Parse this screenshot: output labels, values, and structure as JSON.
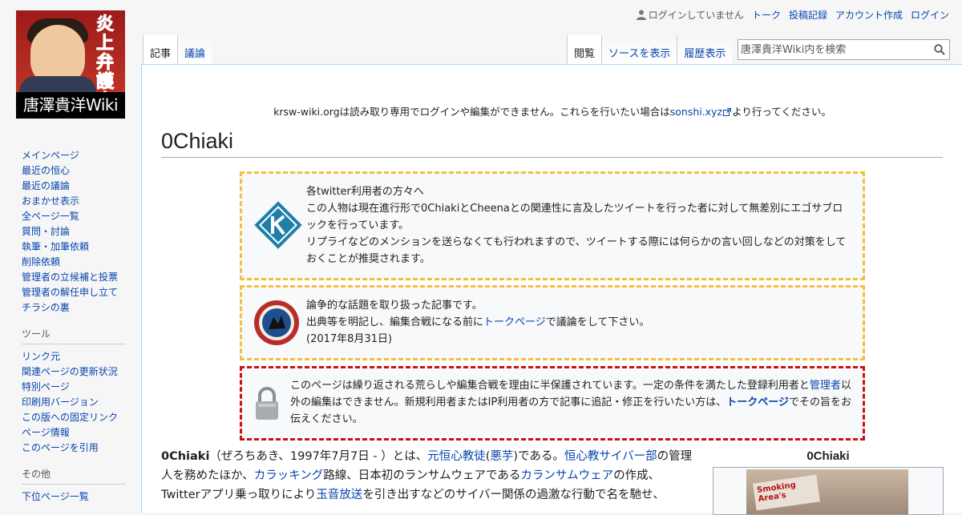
{
  "logo": {
    "title": "唐澤貴洋Wiki",
    "stamp": "炎上弁護士"
  },
  "personal": {
    "not_logged_in": "ログインしていません",
    "links": [
      "トーク",
      "投稿記録",
      "アカウント作成",
      "ログイン"
    ]
  },
  "tabs": {
    "namespace": [
      {
        "label": "記事",
        "selected": true
      },
      {
        "label": "議論",
        "selected": false
      }
    ],
    "views": [
      {
        "label": "閲覧",
        "selected": true
      },
      {
        "label": "ソースを表示",
        "selected": false
      },
      {
        "label": "履歴表示",
        "selected": false
      }
    ]
  },
  "search": {
    "placeholder": "唐澤貴洋Wiki内を検索"
  },
  "sidebar": {
    "navigation": [
      "メインページ",
      "最近の恒心",
      "最近の議論",
      "おまかせ表示",
      "全ページ一覧",
      "質問・討論",
      "執筆・加筆依頼",
      "削除依頼",
      "管理者の立候補と投票",
      "管理者の解任申し立て",
      "チラシの裏"
    ],
    "tools_heading": "ツール",
    "tools": [
      "リンク元",
      "関連ページの更新状況",
      "特別ページ",
      "印刷用バージョン",
      "この版への固定リンク",
      "ページ情報",
      "このページを引用"
    ],
    "other_heading": "その他",
    "other": [
      "下位ページ一覧"
    ]
  },
  "site_notice": {
    "before": "krsw-wiki.orgは読み取り専用でログインや編集ができません。これらを行いたい場合は",
    "link": "sonshi.xyz",
    "after": "より行ってください。"
  },
  "page_title": "0Chiaki",
  "notices": {
    "egosa": {
      "line1": "各twitter利用者の方々へ",
      "line2": "この人物は現在進行形で0ChiakiとCheenaとの関連性に言及したツイートを行った者に対して無差別にエゴサブロックを行っています。",
      "line3": "リプライなどのメンションを送らなくても行われますので、ツイートする際には何らかの言い回しなどの対策をしておくことが推奨されます。"
    },
    "dispute": {
      "line1": "論争的な話題を取り扱った記事です。",
      "line2_before": "出典等を明記し、編集合戦になる前に",
      "line2_link": "トークページ",
      "line2_after": "で議論をして下さい。",
      "date": "(2017年8月31日)"
    },
    "protect": {
      "before": "このページは繰り返される荒らしや編集合戦を理由に半保護されています。一定の条件を満たした登録利用者と",
      "link1": "管理者",
      "middle": "以外の編集はできません。新規利用者またはIP利用者の方で記事に追記・修正を行いたい方は、",
      "link2": "トークページ",
      "after": "でその旨をお伝えください。"
    }
  },
  "lead": {
    "bold": "0Chiaki",
    "t1": "（ぜろちあき、1997年7月7日 - ）とは、",
    "l1": "元恒心教徒",
    "t2": "(",
    "l2": "悪芋",
    "t3": ")である。",
    "l3": "恒心教サイバー部",
    "t4": "の管理人を務めたほか、",
    "l4": "カラッキング",
    "t5": "路線、日本初のランサムウェアである",
    "l5": "カランサムウェア",
    "t6": "の作成、Twitterアプリ乗っ取りにより",
    "l6": "玉音放送",
    "t7": "を引き出すなどのサイバー関係の過激な行動で名を馳せ、"
  },
  "infobox": {
    "caption": "0Chiaki",
    "sign_text": "Smoking Area's"
  },
  "colors": {
    "link": "#0645ad",
    "notice_yellow": "#f0c040",
    "notice_red": "#cc1111"
  }
}
